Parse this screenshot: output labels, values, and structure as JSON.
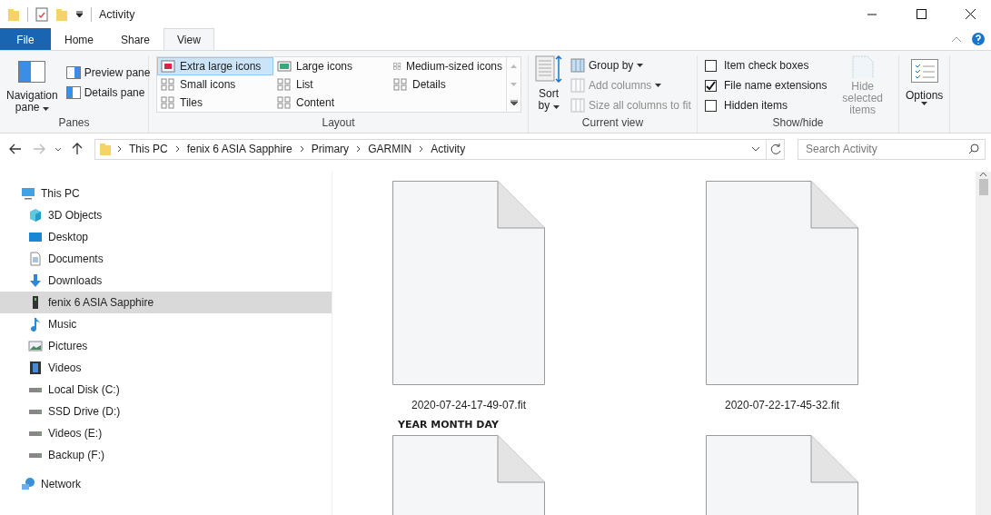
{
  "window": {
    "title": "Activity"
  },
  "tabs": [
    {
      "label": "File",
      "kind": "file",
      "selected": false
    },
    {
      "label": "Home",
      "kind": "tab",
      "selected": false
    },
    {
      "label": "Share",
      "kind": "tab",
      "selected": false
    },
    {
      "label": "View",
      "kind": "tab",
      "selected": true
    }
  ],
  "panes": {
    "title": "Panes",
    "navigation_pane": [
      "Navigation",
      "pane"
    ],
    "buttons": [
      "Preview pane",
      "Details pane"
    ]
  },
  "layout": {
    "title": "Layout",
    "options": [
      {
        "label": "Extra large icons",
        "selected": true
      },
      {
        "label": "Large icons",
        "selected": false
      },
      {
        "label": "Medium-sized icons",
        "selected": false
      },
      {
        "label": "Small icons",
        "selected": false
      },
      {
        "label": "List",
        "selected": false
      },
      {
        "label": "Details",
        "selected": false
      },
      {
        "label": "Tiles",
        "selected": false
      },
      {
        "label": "Content",
        "selected": false
      }
    ]
  },
  "current_view": {
    "title": "Current view",
    "sort_by": [
      "Sort",
      "by"
    ],
    "commands": [
      {
        "label": "Group by",
        "disabled": false
      },
      {
        "label": "Add columns",
        "disabled": true
      },
      {
        "label": "Size all columns to fit",
        "disabled": true
      }
    ]
  },
  "show_hide": {
    "title": "Show/hide",
    "checkboxes": [
      {
        "label": "Item check boxes",
        "checked": false
      },
      {
        "label": "File name extensions",
        "checked": true
      },
      {
        "label": "Hidden items",
        "checked": false
      }
    ],
    "hide_selected": {
      "lines": [
        "Hide selected",
        "items"
      ],
      "disabled": true
    }
  },
  "options": {
    "label": "Options"
  },
  "address": {
    "crumbs": [
      "This PC",
      "fenix 6 ASIA Sapphire",
      "Primary",
      "GARMIN",
      "Activity"
    ]
  },
  "search": {
    "placeholder": "Search Activity"
  },
  "sidebar": {
    "items": [
      {
        "label": "This PC",
        "kind": "pc",
        "selected": false,
        "children": [
          {
            "label": "3D Objects",
            "kind": "cube",
            "selected": false
          },
          {
            "label": "Desktop",
            "kind": "desktop",
            "selected": false
          },
          {
            "label": "Documents",
            "kind": "document",
            "selected": false
          },
          {
            "label": "Downloads",
            "kind": "download",
            "selected": false
          },
          {
            "label": "fenix 6 ASIA Sapphire",
            "kind": "device",
            "selected": true
          },
          {
            "label": "Music",
            "kind": "music",
            "selected": false
          },
          {
            "label": "Pictures",
            "kind": "picture",
            "selected": false
          },
          {
            "label": "Videos",
            "kind": "video",
            "selected": false
          },
          {
            "label": "Local Disk (C:)",
            "kind": "drive",
            "selected": false
          },
          {
            "label": "SSD Drive (D:)",
            "kind": "drive",
            "selected": false
          },
          {
            "label": "Videos (E:)",
            "kind": "drive",
            "selected": false
          },
          {
            "label": "Backup (F:)",
            "kind": "drive",
            "selected": false
          }
        ]
      },
      {
        "label": "Network",
        "kind": "network",
        "selected": false
      }
    ]
  },
  "files": [
    {
      "kind": "file",
      "name": "2020-07-24-17-49-07.fit"
    },
    {
      "kind": "file",
      "name": "2020-07-22-17-45-32.fit"
    },
    {
      "kind": "file"
    },
    {
      "kind": "file"
    }
  ],
  "annotation": "YEAR MONTH DAY"
}
